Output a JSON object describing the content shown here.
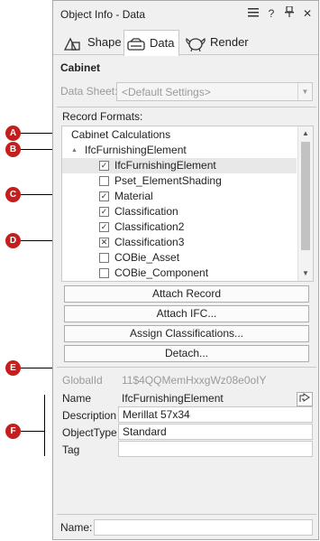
{
  "window": {
    "title": "Object Info - Data",
    "menu_icon": "hamburger-menu-icon",
    "help_label": "?",
    "pin_icon": "pin-icon",
    "close_label": "✕"
  },
  "tabs": [
    {
      "label": "Shape",
      "icon": "shape-icon"
    },
    {
      "label": "Data",
      "icon": "data-icon"
    },
    {
      "label": "Render",
      "icon": "render-icon"
    }
  ],
  "object_name": "Cabinet",
  "data_sheet": {
    "label": "Data Sheet:",
    "value": "<Default Settings>"
  },
  "record_formats": {
    "label": "Record Formats:",
    "items": [
      {
        "label": "Cabinet Calculations",
        "checkbox": null,
        "level": 0
      },
      {
        "label": "IfcFurnishingElement",
        "checkbox": null,
        "level": 0,
        "expander": "▲"
      },
      {
        "label": "IfcFurnishingElement",
        "checkbox": "checked",
        "level": 1
      },
      {
        "label": "Pset_ElementShading",
        "checkbox": "unchecked",
        "level": 1
      },
      {
        "label": "Material",
        "checkbox": "checked",
        "level": 1
      },
      {
        "label": "Classification",
        "checkbox": "checked",
        "level": 1
      },
      {
        "label": "Classification2",
        "checkbox": "checked",
        "level": 1
      },
      {
        "label": "Classification3",
        "checkbox": "crossed",
        "level": 1
      },
      {
        "label": "COBie_Asset",
        "checkbox": "unchecked",
        "level": 1
      },
      {
        "label": "COBie_Component",
        "checkbox": "unchecked",
        "level": 1
      }
    ]
  },
  "buttons": {
    "attach_record": "Attach Record",
    "attach_ifc": "Attach IFC...",
    "assign_classifications": "Assign Classifications...",
    "detach": "Detach..."
  },
  "properties": {
    "globalid": {
      "label": "GlobalId",
      "value": "11$4QQMemHxxgWz08e0oIY"
    },
    "name": {
      "label": "Name",
      "value": "IfcFurnishingElement"
    },
    "description": {
      "label": "Description",
      "value": "Merillat 57x34"
    },
    "object_type": {
      "label": "ObjectType",
      "value": "Standard"
    },
    "tag": {
      "label": "Tag",
      "value": ""
    }
  },
  "footer": {
    "name_label": "Name:",
    "name_value": ""
  },
  "callouts": [
    "A",
    "B",
    "C",
    "D",
    "E",
    "F"
  ],
  "colors": {
    "callout": "#c21f1f",
    "panel_bg": "#f0f0f0"
  }
}
